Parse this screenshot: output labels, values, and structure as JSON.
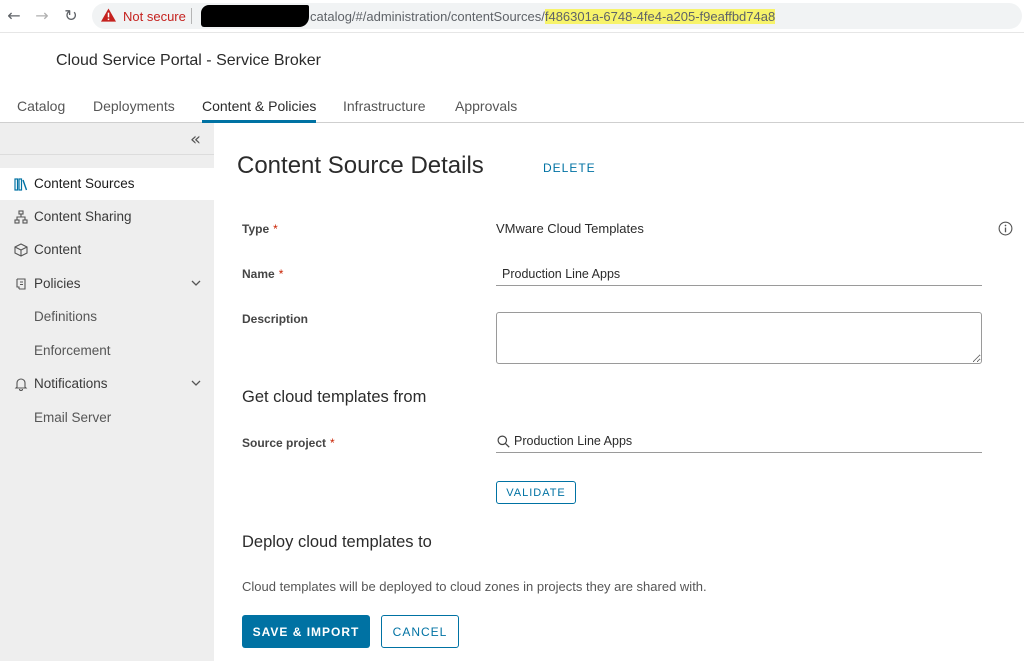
{
  "browser": {
    "back_icon": "arrow-left-icon",
    "forward_icon": "arrow-right-icon",
    "reload_icon": "reload-icon",
    "security_label": "Not secure",
    "url_path": "catalog/#/administration/contentSources/",
    "url_id": "f486301a-6748-4fe4-a205-f9eaffbd74a8"
  },
  "header": {
    "app_title": "Cloud Service Portal - Service Broker"
  },
  "tabs": [
    {
      "label": "Catalog"
    },
    {
      "label": "Deployments"
    },
    {
      "label": "Content & Policies",
      "active": true
    },
    {
      "label": "Infrastructure"
    },
    {
      "label": "Approvals"
    }
  ],
  "sidebar": {
    "collapse_icon": "double-chevron-left-icon",
    "items": [
      {
        "label": "Content Sources",
        "icon": "library-icon",
        "active": true
      },
      {
        "label": "Content Sharing",
        "icon": "sitemap-icon"
      },
      {
        "label": "Content",
        "icon": "cube-icon"
      },
      {
        "label": "Policies",
        "icon": "scroll-icon",
        "expandable": true
      },
      {
        "label": "Definitions",
        "sub": true
      },
      {
        "label": "Enforcement",
        "sub": true
      },
      {
        "label": "Notifications",
        "icon": "bell-icon",
        "expandable": true
      },
      {
        "label": "Email Server",
        "sub": true
      }
    ]
  },
  "main": {
    "title": "Content Source Details",
    "delete_label": "DELETE",
    "type_label": "Type",
    "type_value": "VMware Cloud Templates",
    "name_label": "Name",
    "name_value": "Production Line Apps",
    "description_label": "Description",
    "description_value": "",
    "get_section": "Get cloud templates from",
    "source_project_label": "Source project",
    "source_project_value": "Production Line Apps",
    "validate_label": "VALIDATE",
    "deploy_section": "Deploy cloud templates to",
    "deploy_note": "Cloud templates will be deployed to cloud zones in projects they are shared with.",
    "save_label": "SAVE & IMPORT",
    "cancel_label": "CANCEL",
    "required_mark": "*"
  },
  "colors": {
    "accent": "#0072a3",
    "required": "#c92100",
    "sidebar_bg": "#eeeeee",
    "url_highlight": "#f7f36a"
  }
}
